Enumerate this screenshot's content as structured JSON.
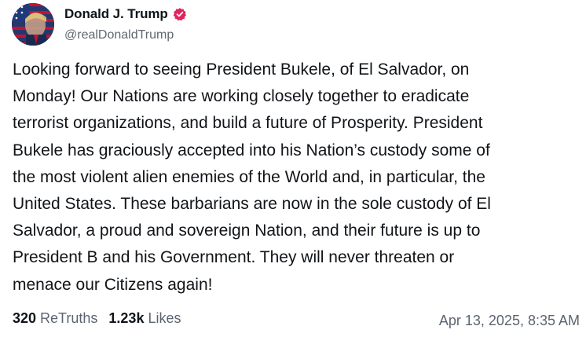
{
  "author": {
    "display_name": "Donald J. Trump",
    "handle": "@realDonaldTrump",
    "verified_icon": "verified-badge-icon",
    "verified_color": "#e0245e"
  },
  "post": {
    "lines": [
      "Looking forward to seeing President Bukele, of El Salvador, on",
      "Monday! Our Nations are working closely together to eradicate",
      "terrorist organizations, and build a future of Prosperity. President",
      "Bukele has graciously accepted into his Nation’s custody some of",
      "the most violent alien enemies of the World and, in particular, the",
      "United States. These barbarians are now in the sole custody of El",
      "Salvador, a proud and sovereign Nation, and their future is up to",
      "President B and his Government. They will never threaten or",
      "menace our Citizens again!"
    ]
  },
  "stats": {
    "retruths_count": "320",
    "retruths_label": "ReTruths",
    "likes_count": "1.23k",
    "likes_label": "Likes"
  },
  "timestamp": "Apr 13, 2025, 8:35 AM"
}
